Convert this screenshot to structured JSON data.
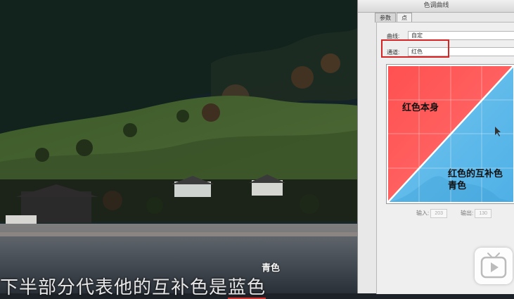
{
  "dialog": {
    "title": "色调曲线",
    "tabs": [
      "参数",
      "点"
    ],
    "curve_label": "曲线:",
    "curve_value": "自定",
    "channel_label": "通道:",
    "channel_value": "红色",
    "input_label": "输入:",
    "input_value": "203",
    "output_label": "输出:",
    "output_value": "130"
  },
  "annotations": {
    "red_self": "红色本身",
    "complement_line1": "红色的互补色",
    "complement_line2": "青色",
    "top_label": "青色"
  },
  "subtitle": {
    "text": "下半部分代表他的互补色是",
    "highlight": "蓝色"
  },
  "colors": {
    "red_region": "#ff5a5a",
    "cyan_region": "#5ab8ea",
    "highlight_box": "#d42424"
  }
}
